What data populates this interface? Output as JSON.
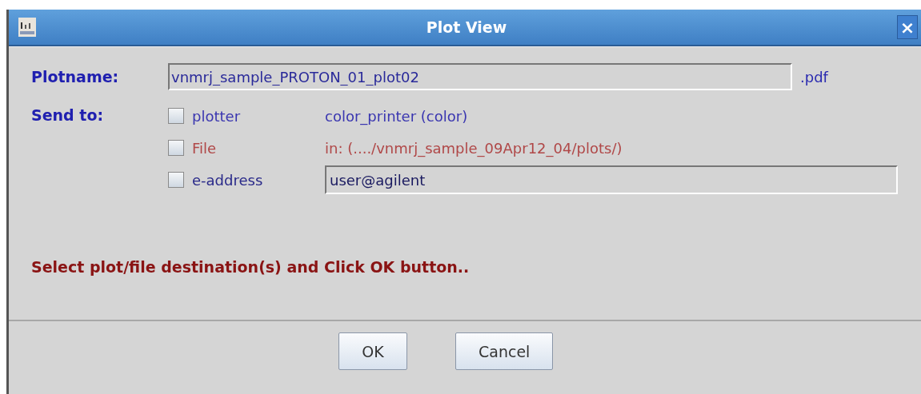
{
  "window": {
    "title": "Plot View",
    "close": "×"
  },
  "plotname": {
    "label": "Plotname:",
    "value": "vnmrj_sample_PROTON_01_plot02",
    "suffix": ".pdf"
  },
  "send_to": {
    "label": "Send to:",
    "destinations": [
      {
        "kind": "text",
        "label": "plotter",
        "checked": false,
        "color": "#3a36b0",
        "detail": "color_printer (color)"
      },
      {
        "kind": "text",
        "label": "File",
        "checked": false,
        "color": "#b04848",
        "detail": "in:  (..../vnmrj_sample_09Apr12_04/plots/)"
      },
      {
        "kind": "field",
        "label": "e-address",
        "checked": false,
        "color": "#2a2a8a",
        "value": "user@agilent"
      }
    ]
  },
  "message": "Select plot/file destination(s) and Click OK button..",
  "buttons": [
    "OK",
    "Cancel"
  ]
}
